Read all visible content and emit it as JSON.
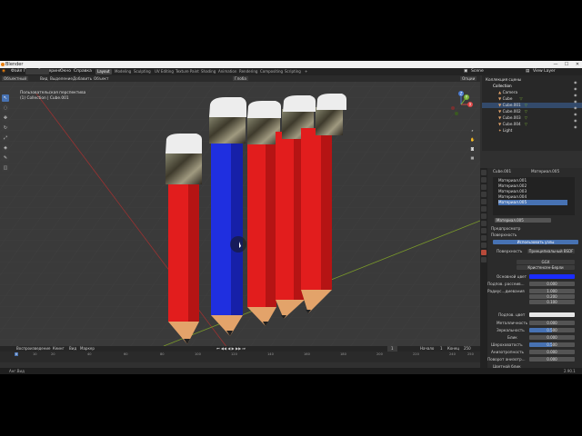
{
  "window": {
    "title": "Blender",
    "controls": [
      "—",
      "☐",
      "✕"
    ]
  },
  "menubar": {
    "menus": [
      "Файл",
      "Правка",
      "Рендеринг",
      "Окно",
      "Справка"
    ],
    "workspaces": [
      "Layout",
      "Modeling",
      "Sculpting",
      "UV Editing",
      "Texture Paint",
      "Shading",
      "Animation",
      "Rendering",
      "Compositing",
      "Scripting",
      "+"
    ],
    "active_workspace": "Layout",
    "scene_label": "Scene",
    "view_layer_label": "View Layer"
  },
  "viewport_header": {
    "mode": "Объектный",
    "menus": [
      "Вид",
      "Выделение",
      "Добавить",
      "Объект"
    ],
    "transform": "Глоба",
    "options": "Опции"
  },
  "viewport_info": {
    "line1": "Пользовательская перспектива",
    "line2": "(1) Collection | Cube.001"
  },
  "gizmo": {
    "x": "X",
    "y": "Y",
    "z": "Z"
  },
  "tools": [
    "↖",
    "◌",
    "✥",
    "↻",
    "⤢",
    "◈",
    "✎",
    "◫"
  ],
  "outliner": {
    "root": "Коллекция сцены",
    "items": [
      {
        "label": "Collection",
        "icon": "collection-icon"
      },
      {
        "label": "Camera",
        "icon": "camera-icon"
      },
      {
        "label": "Cube",
        "icon": "mesh-icon"
      },
      {
        "label": "Cube.001",
        "icon": "mesh-icon"
      },
      {
        "label": "Cube.002",
        "icon": "mesh-icon"
      },
      {
        "label": "Cube.003",
        "icon": "mesh-icon"
      },
      {
        "label": "Cube.004",
        "icon": "mesh-icon"
      },
      {
        "label": "Light",
        "icon": "light-icon"
      }
    ]
  },
  "properties": {
    "object_name": "Cube.001",
    "material_name_header": "Материал.005",
    "material_slots": [
      "Материал.001",
      "Материал.002",
      "Материал.003",
      "Материал.004",
      "Материал.005"
    ],
    "selected_slot": "Материал.005",
    "material_field": "Материал.005",
    "sections": {
      "preview": "Предпросмотр",
      "surface": "Поверхность"
    },
    "use_nodes": "Использовать узлы",
    "surface_label": "Поверхность",
    "surface_value": "Принципиальный BSDF",
    "ggx": "GGX",
    "subsurface_method": "Кристенсен-Берли",
    "base_color_label": "Основной цвет",
    "base_color": "#1a2cff",
    "subsurface_label": "Подпов. рассеив...",
    "subsurface_value": "0.000",
    "radius_label": "Радиус...диевания",
    "radius_values": [
      "1.000",
      "0.200",
      "0.100"
    ],
    "subsurface_color_label": "Подпов. цвет",
    "metallic_label": "Металличность",
    "metallic_value": "0.000",
    "specular_label": "Зеркальность",
    "specular_value": "0.500",
    "specular_tint_label": "Блик",
    "specular_tint_value": "0.000",
    "roughness_label": "Шероховатость",
    "roughness_value": "0.500",
    "aniso_label": "Анизотропность",
    "aniso_value": "0.000",
    "aniso_rot_label": "Поворот анизотр...",
    "aniso_rot_value": "0.000",
    "sheen_label": "Цветной блик"
  },
  "timeline": {
    "menus": [
      "Воспроизведение",
      "Кеинг",
      "Вид",
      "Маркер"
    ],
    "current_frame": "1",
    "start_label": "Начало",
    "start_value": "1",
    "end_label": "Конец",
    "end_value": "250",
    "ticks": [
      "0",
      "10",
      "20",
      "40",
      "60",
      "80",
      "100",
      "120",
      "140",
      "160",
      "180",
      "200",
      "220",
      "240",
      "250"
    ]
  },
  "statusbar": {
    "left": "Анг.Вид",
    "right": "2.90.1"
  },
  "colors": {
    "accent": "#4772b3",
    "red_pencil": "#e21d1d",
    "blue_pencil": "#1f2fe0",
    "bg": "#303030"
  }
}
